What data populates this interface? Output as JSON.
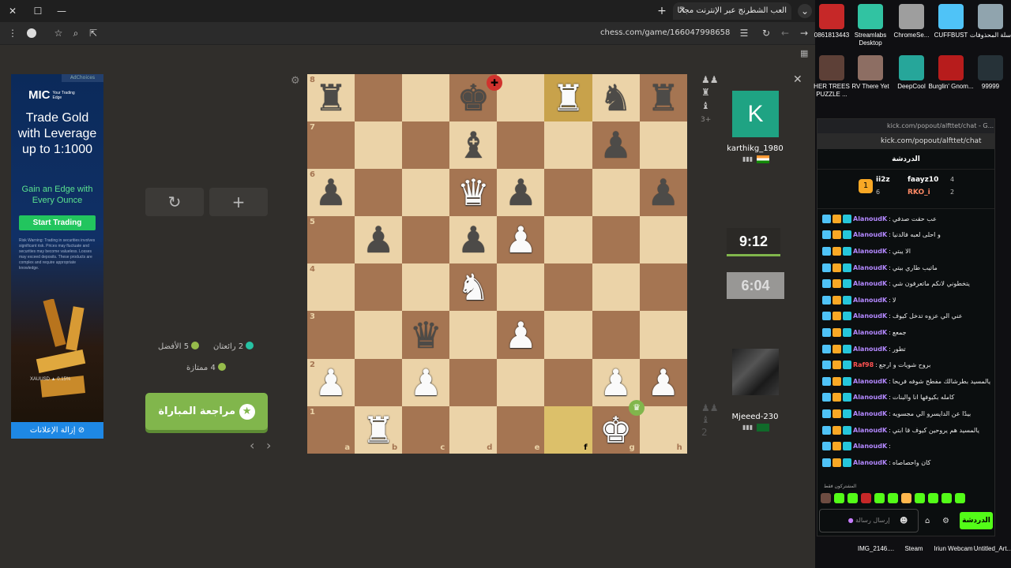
{
  "browser": {
    "tab_title": "العب الشطرنج عبر الإنترنت مجانًا",
    "url": "chess.com/game/166047998658",
    "new_tab": "+",
    "close": "✕"
  },
  "ad": {
    "badge": "AdChoices",
    "logo": "MIC",
    "logo_tag": "Your Trading Edge",
    "headline": "Trade Gold with Leverage up to 1:1000",
    "subhead": "Gain an Edge with Every Ounce",
    "cta": "Start Trading",
    "risk": "Risk Warning: Trading in securities involves significant risk. Prices may fluctuate and securities may become valueless. Losses may exceed deposits. These products are complex and require appropriate knowledge.",
    "ticker": "XAUUSD ▲ 0.15%",
    "remove": "إزالة الإعلانات"
  },
  "controls": {
    "rematch_icon": "↻",
    "new_game_icon": "+"
  },
  "stats": {
    "brilliant": "2 رائعتان",
    "best": "5 الأفضل",
    "great": "4 ممتازة"
  },
  "review_button": "مراجعة المباراة",
  "nav": {
    "prev": "‹",
    "next": "›"
  },
  "board": {
    "ranks": [
      "8",
      "7",
      "6",
      "5",
      "4",
      "3",
      "2",
      "1"
    ],
    "files": [
      "a",
      "b",
      "c",
      "d",
      "e",
      "f",
      "g",
      "h"
    ],
    "position": [
      [
        "bR",
        "",
        "",
        "bK",
        "",
        "wR",
        "bN",
        "bR"
      ],
      [
        "",
        "",
        "",
        "bB",
        "",
        "",
        "bP",
        ""
      ],
      [
        "bP",
        "",
        "",
        "wQ",
        "bP",
        "",
        "",
        "bP"
      ],
      [
        "",
        "bP",
        "",
        "bP",
        "wP",
        "",
        "",
        ""
      ],
      [
        "",
        "",
        "",
        "wN",
        "",
        "",
        "",
        ""
      ],
      [
        "",
        "",
        "bQ",
        "",
        "wP",
        "",
        "",
        ""
      ],
      [
        "wP",
        "",
        "wP",
        "",
        "",
        "",
        "wP",
        "wP"
      ],
      [
        "",
        "wR",
        "",
        "",
        "",
        "",
        "wK",
        ""
      ]
    ],
    "highlight": [
      "f8",
      "f1"
    ]
  },
  "players": {
    "top": {
      "initial": "K",
      "name": "karthikg_1980",
      "clock": "9:12"
    },
    "bottom": {
      "name": "Mjeeed-230",
      "clock": "6:04"
    }
  },
  "side": {
    "moves_count": "3+",
    "move_count_bottom": "2"
  },
  "desktop_icons": [
    {
      "label": "0861813443",
      "color": "#c62828"
    },
    {
      "label": "Streamlabs Desktop",
      "color": "#31c3a2"
    },
    {
      "label": "ChromeSe...",
      "color": "#9e9e9e"
    },
    {
      "label": "CUFFBUST",
      "color": "#4fc3f7"
    },
    {
      "label": "سلة المحذوفات",
      "color": "#90a4ae"
    },
    {
      "label": "HER TREES PUZZLE ...",
      "color": "#5d4037"
    },
    {
      "label": "RV There Yet",
      "color": "#8d6e63"
    },
    {
      "label": "DeepCool",
      "color": "#26a69a"
    },
    {
      "label": "Burglin' Gnom...",
      "color": "#b71c1c"
    },
    {
      "label": "99999",
      "color": "#263238"
    }
  ],
  "taskbar_icons": [
    {
      "label": "IMG_2146...."
    },
    {
      "label": "Steam"
    },
    {
      "label": "Iriun Webcam"
    },
    {
      "label": "Untitled_Art..."
    }
  ],
  "chat": {
    "window_title": "kick.com/popout/alfttet/chat - G...",
    "url": "kick.com/popout/alfttet/chat",
    "header": "الدردشة",
    "leaderboard": [
      {
        "name": "ii2z",
        "count": "",
        "color": "#fff"
      },
      {
        "name": "faayz10",
        "count": "4",
        "color": "#fff"
      },
      {
        "name": "RKO_i",
        "count": "2",
        "color": "#ff8a65"
      }
    ],
    "leader_rank": "6",
    "messages": [
      {
        "user": "AlanoudK",
        "text": "عب حقت صدفي",
        "color": "#b388ff"
      },
      {
        "user": "AlanoudK",
        "text": "و احلى لعبه فالدنيا",
        "color": "#b388ff"
      },
      {
        "user": "AlanoudK",
        "text": "الا يبتي",
        "color": "#b388ff"
      },
      {
        "user": "AlanoudK",
        "text": "ماتيب طاري بيتي",
        "color": "#b388ff"
      },
      {
        "user": "AlanoudK",
        "text": "يتخطوني لانكم ماتعرفون شي",
        "color": "#b388ff"
      },
      {
        "user": "AlanoudK",
        "text": "لا",
        "color": "#b388ff"
      },
      {
        "user": "AlanoudK",
        "text": "عني الي عزوه تدخل كيوف",
        "color": "#b388ff"
      },
      {
        "user": "AlanoudK",
        "text": "جمعع",
        "color": "#b388ff"
      },
      {
        "user": "AlanoudK",
        "text": "تطور",
        "color": "#b388ff"
      },
      {
        "user": "Raf98",
        "text": "بروح شويات و ارجع",
        "color": "#ff5252"
      },
      {
        "user": "AlanoudK",
        "text": "يالمسيد بطرشالك مفطح شوفه فريحا",
        "color": "#b388ff"
      },
      {
        "user": "AlanoudK",
        "text": "كامله بكيوفها انا والبنات",
        "color": "#b388ff"
      },
      {
        "user": "AlanoudK",
        "text": "بيدًا عن الدايسرو الي مجسويه",
        "color": "#b388ff"
      },
      {
        "user": "AlanoudK",
        "text": "يالمسيد هم يروحين كيوف قا ابتي",
        "color": "#b388ff"
      },
      {
        "user": "AlanoudK",
        "text": "",
        "color": "#b388ff"
      },
      {
        "user": "AlanoudK",
        "text": "كان واحصاصاه",
        "color": "#b388ff"
      }
    ],
    "subscribers_label": "المشتركون فقط",
    "input_placeholder": "إرسال رسالة",
    "send": "الدردشة"
  },
  "colors": {
    "board_light": "#ebd3a8",
    "board_dark": "#a57552",
    "accent_green": "#81b64c",
    "kick_green": "#53fc18"
  }
}
